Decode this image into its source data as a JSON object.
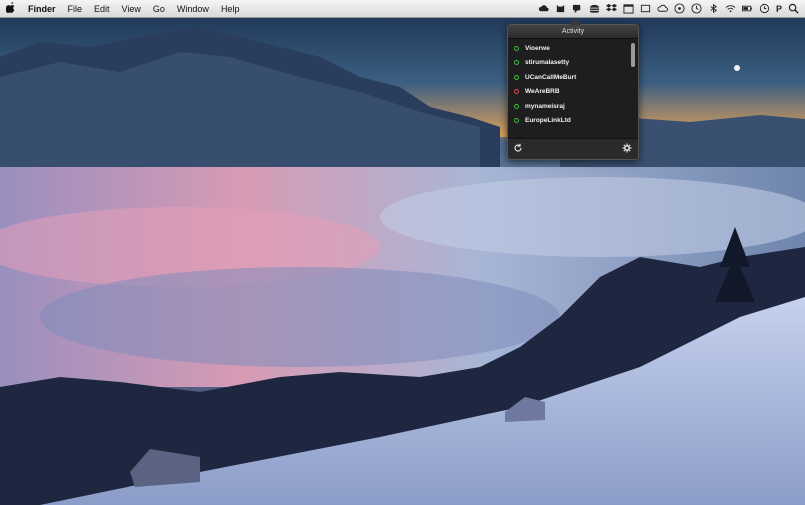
{
  "menubar": {
    "apple_icon": "apple-logo",
    "app_name": "Finder",
    "menus": [
      "File",
      "Edit",
      "View",
      "Go",
      "Window",
      "Help"
    ],
    "status_icons": [
      "cloud-icon",
      "cat-icon",
      "chat-icon",
      "hamburger-icon",
      "dropbox-icon",
      "calendar-icon",
      "window-icon",
      "cloud-outline-icon",
      "music-icon",
      "clock-icon",
      "bluetooth-icon",
      "wifi-icon",
      "battery-icon",
      "time-machine-icon"
    ],
    "user_letter": "P",
    "search_icon": "spotlight-icon"
  },
  "activity": {
    "title": "Activity",
    "items": [
      {
        "name": "Vioerwe",
        "status": "online"
      },
      {
        "name": "stirumalasetty",
        "status": "online"
      },
      {
        "name": "UCanCallMeBurt",
        "status": "online"
      },
      {
        "name": "WeAreBRB",
        "status": "away"
      },
      {
        "name": "mynameisraj",
        "status": "online"
      },
      {
        "name": "EuropeLinkLtd",
        "status": "online"
      }
    ]
  },
  "colors": {
    "online": "#3cc13c",
    "away": "#e34b4b",
    "popover_bg": "#1e1e1e"
  }
}
